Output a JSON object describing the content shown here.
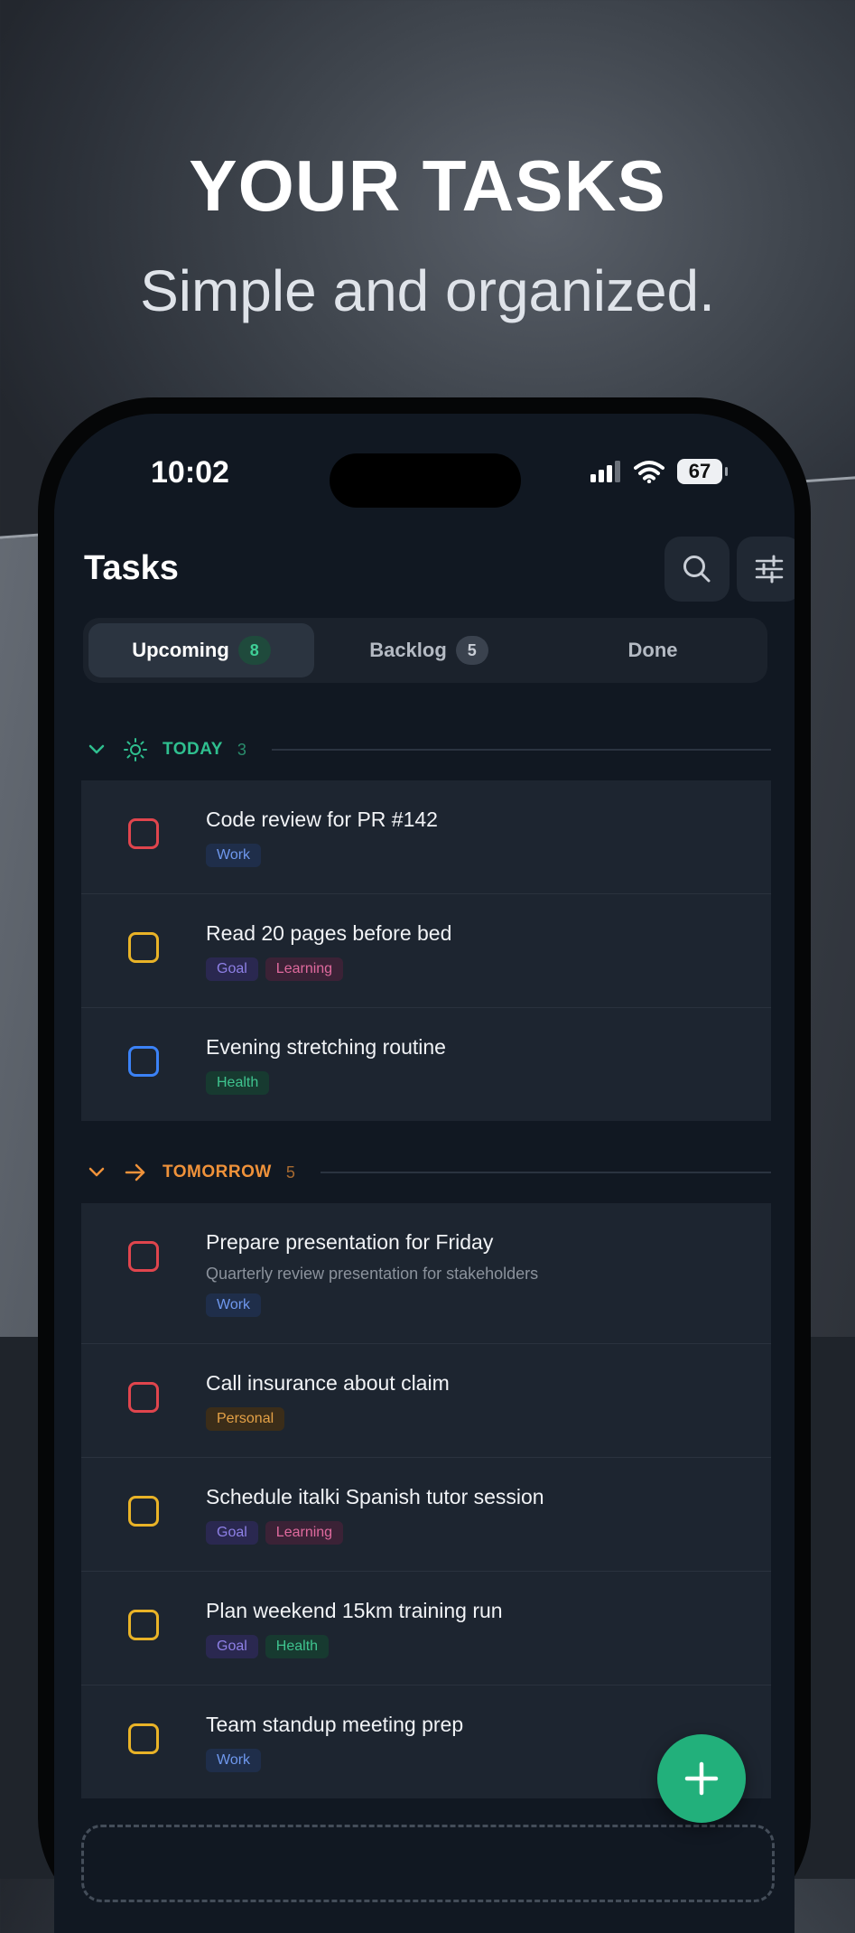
{
  "hero": {
    "title": "YOUR TASKS",
    "subtitle": "Simple and organized."
  },
  "status_bar": {
    "time": "10:02",
    "battery": "67"
  },
  "header": {
    "title": "Tasks"
  },
  "tabs": [
    {
      "label": "Upcoming",
      "count": "8",
      "active": true
    },
    {
      "label": "Backlog",
      "count": "5",
      "active": false
    },
    {
      "label": "Done",
      "count": "",
      "active": false
    }
  ],
  "sections": [
    {
      "label": "TODAY",
      "count": "3",
      "color": "#2fbf8f",
      "tasks": [
        {
          "title": "Code review for PR #142",
          "description": "",
          "check_color": "#e0454d",
          "tags": [
            "Work"
          ]
        },
        {
          "title": "Read 20 pages before bed",
          "description": "",
          "check_color": "#e9b327",
          "tags": [
            "Goal",
            "Learning"
          ]
        },
        {
          "title": "Evening stretching routine",
          "description": "",
          "check_color": "#3b82f6",
          "tags": [
            "Health"
          ]
        }
      ]
    },
    {
      "label": "TOMORROW",
      "count": "5",
      "color": "#f0923a",
      "tasks": [
        {
          "title": "Prepare presentation for Friday",
          "description": "Quarterly review presentation for stakeholders",
          "check_color": "#e0454d",
          "tags": [
            "Work"
          ]
        },
        {
          "title": "Call insurance about claim",
          "description": "",
          "check_color": "#e0454d",
          "tags": [
            "Personal"
          ]
        },
        {
          "title": "Schedule italki Spanish tutor session",
          "description": "",
          "check_color": "#e9b327",
          "tags": [
            "Goal",
            "Learning"
          ]
        },
        {
          "title": "Plan weekend 15km training run",
          "description": "",
          "check_color": "#e9b327",
          "tags": [
            "Goal",
            "Health"
          ]
        },
        {
          "title": "Team standup meeting prep",
          "description": "",
          "check_color": "#e9b327",
          "tags": [
            "Work"
          ]
        }
      ]
    }
  ],
  "icons": {
    "search": "search-icon",
    "filter": "sliders-icon",
    "add": "plus-icon",
    "today": "sun-icon",
    "tomorrow": "arrow-right-icon",
    "collapse": "chevron-down-icon"
  }
}
